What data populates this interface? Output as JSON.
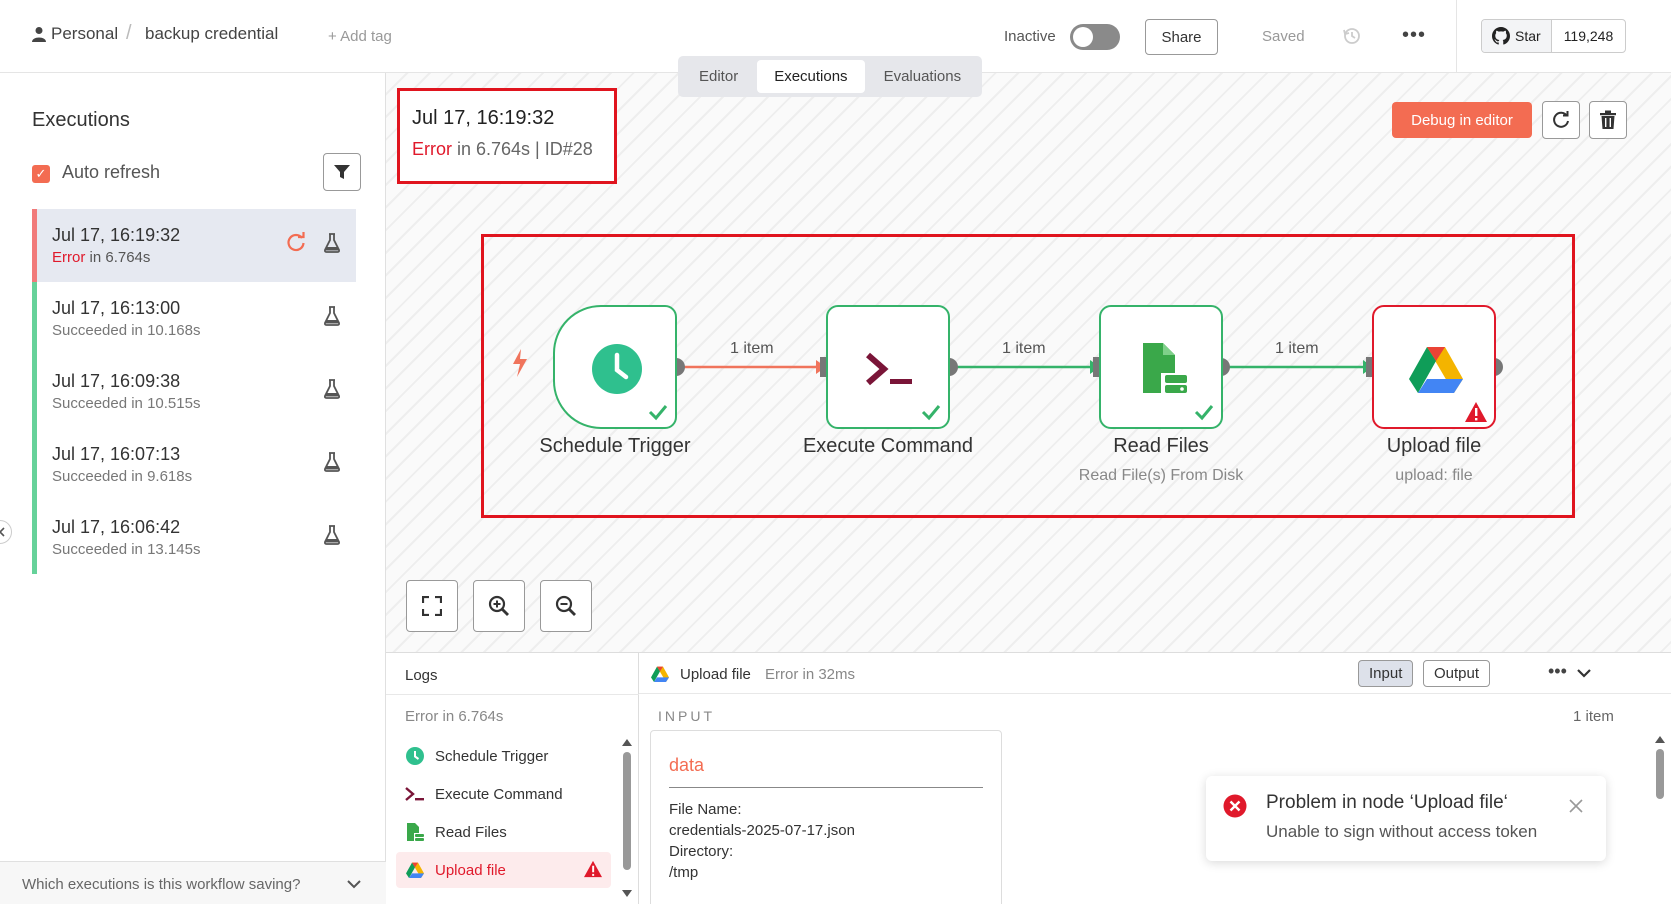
{
  "header": {
    "breadcrumb_project": "Personal",
    "breadcrumb_separator": "/",
    "workflow_name": "backup credential",
    "add_tag": "+ Add tag",
    "active_label": "Inactive",
    "active": false,
    "share_label": "Share",
    "saved_label": "Saved",
    "more_label": "•••",
    "github_star_label": "Star",
    "github_star_count": "119,248"
  },
  "tabs": [
    {
      "label": "Editor",
      "active": false
    },
    {
      "label": "Executions",
      "active": true
    },
    {
      "label": "Evaluations",
      "active": false
    }
  ],
  "sidebar": {
    "title": "Executions",
    "auto_refresh_label": "Auto refresh",
    "auto_refresh_checked": true,
    "executions": [
      {
        "time": "Jul 17, 16:19:32",
        "status": "Error",
        "duration": " in 6.764s",
        "state": "error",
        "active": true
      },
      {
        "time": "Jul 17, 16:13:00",
        "status": "Succeeded in 10.168s",
        "duration": "",
        "state": "success",
        "active": false
      },
      {
        "time": "Jul 17, 16:09:38",
        "status": "Succeeded in 10.515s",
        "duration": "",
        "state": "success",
        "active": false
      },
      {
        "time": "Jul 17, 16:07:13",
        "status": "Succeeded in 9.618s",
        "duration": "",
        "state": "success",
        "active": false
      },
      {
        "time": "Jul 17, 16:06:42",
        "status": "Succeeded in 13.145s",
        "duration": "",
        "state": "success",
        "active": false
      }
    ],
    "bottom_question": "Which executions is this workflow saving?"
  },
  "execution": {
    "time": "Jul 17, 16:19:32",
    "status": "Error",
    "detail": " in 6.764s | ID#28",
    "debug_label": "Debug in editor"
  },
  "workflow": {
    "nodes": [
      {
        "name": "Schedule Trigger",
        "subtitle": "",
        "icon": "clock-icon",
        "state": "success"
      },
      {
        "name": "Execute Command",
        "subtitle": "",
        "icon": "terminal-icon",
        "state": "success"
      },
      {
        "name": "Read Files",
        "subtitle": "Read File(s) From Disk",
        "icon": "file-disk-icon",
        "state": "success"
      },
      {
        "name": "Upload file",
        "subtitle": "upload: file",
        "icon": "google-drive-icon",
        "state": "error"
      }
    ],
    "edges": [
      "1 item",
      "1 item",
      "1 item"
    ]
  },
  "logs": {
    "title": "Logs",
    "summary": "Error in 6.764s",
    "items": [
      {
        "name": "Schedule Trigger",
        "icon": "clock-icon",
        "error": false
      },
      {
        "name": "Execute Command",
        "icon": "terminal-icon",
        "error": false
      },
      {
        "name": "Read Files",
        "icon": "file-disk-icon",
        "error": false
      },
      {
        "name": "Upload file",
        "icon": "google-drive-icon",
        "error": true
      }
    ],
    "selected_node": "Upload file",
    "selected_status": "Error in 32ms",
    "input_label": "Input",
    "output_label": "Output",
    "section_label": "INPUT",
    "item_count": "1 item",
    "data_title": "data",
    "fields": [
      {
        "label": "File Name:",
        "value": "credentials-2025-07-17.json"
      },
      {
        "label": "Directory:",
        "value": "/tmp"
      }
    ]
  },
  "toast": {
    "title": "Problem in node ‘Upload file‘",
    "message": "Unable to sign without access token"
  },
  "colors": {
    "accent": "#f36c52",
    "error": "#e0192b",
    "success": "#35b36a",
    "highlight_box": "#e0141e"
  }
}
